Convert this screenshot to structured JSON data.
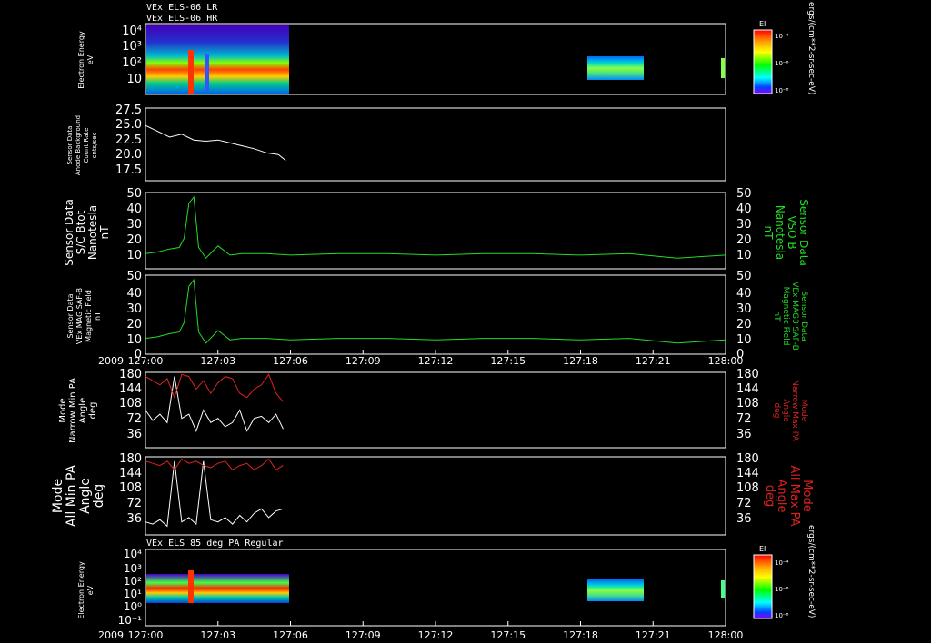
{
  "titles": {
    "top_line1": "VEx ELS-06 LR",
    "top_line2": "VEx ELS-06 HR",
    "bottom": "VEx ELS 85 deg PA Regular"
  },
  "colors": {
    "background": "#000000",
    "axes": "#ffffff",
    "white_trace": "#ffffff",
    "green_trace": "#22dd22",
    "red_trace": "#dd2222"
  },
  "x_axis": {
    "year_label": "2009",
    "tick_labels": [
      "127:00",
      "127:03",
      "127:06",
      "127:09",
      "127:12",
      "127:15",
      "127:18",
      "127:21",
      "128:00"
    ],
    "tick_values": [
      0,
      3,
      6,
      9,
      12,
      15,
      18,
      21,
      24
    ],
    "range": [
      0,
      24
    ]
  },
  "colorbar": {
    "label": "EI",
    "tick_labels": [
      "10⁻⁴",
      "10⁻⁶",
      "10⁻⁸"
    ],
    "right_label_top": "ergs/(cm**2-sr-sec-eV)",
    "right_label_bottom": "ergs/(cm**2-sr-sec-eV)"
  },
  "panels": {
    "p1": {
      "ylabel": [
        "Electron Energy",
        "eV"
      ],
      "ticks": [
        "10⁴",
        "10³",
        "10²",
        "10"
      ]
    },
    "p2": {
      "ylabel": [
        "Sensor Data",
        "Anode Background",
        "Count Rate",
        "cnts/sec"
      ],
      "ticks": [
        "27.5",
        "25.0",
        "22.5",
        "20.0",
        "17.5"
      ]
    },
    "p3": {
      "ylabel": [
        "Sensor Data",
        "S/C Btot",
        "Nanotesla",
        "nT"
      ],
      "ticks": [
        "50",
        "40",
        "30",
        "20",
        "10"
      ],
      "rlabel": [
        "Sensor Data",
        "VSO B",
        "Nanotesla",
        "nT"
      ]
    },
    "p4": {
      "ylabel": [
        "Sensor Data",
        "VEx MAG SAF-B",
        "Magnetic Field",
        "nT"
      ],
      "ticks": [
        "50",
        "40",
        "30",
        "20",
        "10",
        "0"
      ],
      "rlabel": [
        "Sensor Data",
        "VEx MAG3 SAF-B",
        "Magnetic Field",
        "nT"
      ]
    },
    "p5": {
      "ylabel": [
        "Mode",
        "Narrow Min PA",
        "Angle",
        "deg"
      ],
      "ticks": [
        "180",
        "144",
        "108",
        "72",
        "36"
      ],
      "rlabel": [
        "Mode",
        "Narrow Max PA",
        "Angle",
        "deg"
      ]
    },
    "p6": {
      "ylabel": [
        "Mode",
        "All Min PA",
        "Angle",
        "deg"
      ],
      "ticks": [
        "180",
        "144",
        "108",
        "72",
        "36"
      ],
      "rlabel": [
        "Mode",
        "All Max PA",
        "Angle",
        "deg"
      ]
    },
    "p7": {
      "ylabel": [
        "Electron Energy",
        "eV"
      ],
      "ticks": [
        "10⁴",
        "10³",
        "10²",
        "10¹",
        "10⁰",
        "10⁻¹"
      ]
    }
  },
  "chart_data": [
    {
      "type": "heatmap",
      "title": "VEx ELS-06 LR / VEx ELS-06 HR",
      "ylabel": "Electron Energy eV",
      "y_scale": "log",
      "coverage_minutes": [
        [
          0,
          5.9
        ],
        [
          18.0,
          20.3
        ],
        [
          23.9,
          24.0
        ]
      ]
    },
    {
      "type": "line",
      "ylabel": "Sensor Data Anode Background Count Rate cnts/sec",
      "ylim": [
        15.0,
        27.5
      ],
      "x": [
        0.0,
        0.5,
        1.0,
        1.5,
        2.0,
        2.5,
        3.0,
        3.5,
        4.0,
        4.5,
        5.0,
        5.5,
        5.8
      ],
      "series": [
        {
          "values": [
            24.5,
            23.5,
            22.5,
            23.0,
            22.0,
            21.8,
            22.0,
            21.5,
            21.0,
            20.5,
            19.8,
            19.5,
            18.5
          ]
        }
      ]
    },
    {
      "type": "line",
      "ylabel": "Sensor Data S/C Btot Nanotesla nT",
      "ylim": [
        0,
        50
      ],
      "x": [
        0.0,
        0.5,
        1.0,
        1.4,
        1.6,
        1.8,
        2.0,
        2.2,
        2.5,
        3.0,
        3.5,
        4.0,
        5.0,
        6.0,
        8.0,
        10.0,
        12.0,
        14.0,
        16.0,
        18.0,
        20.0,
        22.0,
        24.0
      ],
      "series": [
        {
          "values": [
            10,
            11,
            13,
            14,
            20,
            43,
            47,
            14,
            7,
            15,
            9,
            10,
            10,
            9,
            10,
            10,
            9,
            10,
            10,
            9,
            10,
            7,
            9
          ]
        }
      ]
    },
    {
      "type": "line",
      "ylabel": "Sensor Data VEx MAG SAF-B Magnetic Field nT",
      "ylim": [
        0,
        50
      ],
      "x": [
        0.0,
        0.5,
        1.0,
        1.4,
        1.6,
        1.8,
        2.0,
        2.2,
        2.5,
        3.0,
        3.5,
        4.0,
        5.0,
        6.0,
        8.0,
        10.0,
        12.0,
        14.0,
        16.0,
        18.0,
        20.0,
        22.0,
        24.0
      ],
      "series": [
        {
          "values": [
            10,
            11,
            13,
            14,
            20,
            43,
            47,
            14,
            7,
            15,
            9,
            10,
            10,
            9,
            10,
            10,
            9,
            10,
            10,
            9,
            10,
            7,
            9
          ]
        }
      ]
    },
    {
      "type": "line",
      "ylabel": "Mode Narrow Min PA Angle deg",
      "ylim": [
        0,
        180
      ],
      "x": [
        0.0,
        0.3,
        0.6,
        0.9,
        1.2,
        1.5,
        1.8,
        2.1,
        2.4,
        2.7,
        3.0,
        3.3,
        3.6,
        3.9,
        4.2,
        4.5,
        4.8,
        5.1,
        5.4,
        5.7
      ],
      "series": [
        {
          "values": [
            90,
            65,
            80,
            60,
            170,
            70,
            80,
            40,
            90,
            60,
            70,
            50,
            60,
            90,
            40,
            70,
            75,
            60,
            80,
            45
          ]
        },
        {
          "values": [
            170,
            160,
            150,
            165,
            120,
            175,
            170,
            140,
            160,
            130,
            155,
            170,
            165,
            130,
            120,
            140,
            150,
            175,
            130,
            110
          ]
        }
      ]
    },
    {
      "type": "line",
      "ylabel": "Mode All Min PA Angle deg",
      "ylim": [
        0,
        180
      ],
      "x": [
        0.0,
        0.3,
        0.6,
        0.9,
        1.2,
        1.5,
        1.8,
        2.1,
        2.4,
        2.7,
        3.0,
        3.3,
        3.6,
        3.9,
        4.2,
        4.5,
        4.8,
        5.1,
        5.4,
        5.7
      ],
      "series": [
        {
          "values": [
            30,
            25,
            35,
            20,
            170,
            30,
            40,
            25,
            170,
            35,
            30,
            40,
            25,
            45,
            30,
            50,
            60,
            40,
            55,
            60
          ]
        },
        {
          "values": [
            170,
            165,
            160,
            170,
            150,
            175,
            165,
            170,
            160,
            155,
            165,
            170,
            150,
            160,
            165,
            150,
            160,
            175,
            150,
            160
          ]
        }
      ]
    },
    {
      "type": "heatmap",
      "title": "VEx ELS 85 deg PA Regular",
      "ylabel": "Electron Energy eV",
      "y_scale": "log",
      "coverage_minutes": [
        [
          0,
          5.9
        ],
        [
          18.0,
          20.3
        ],
        [
          23.9,
          24.0
        ]
      ]
    }
  ]
}
